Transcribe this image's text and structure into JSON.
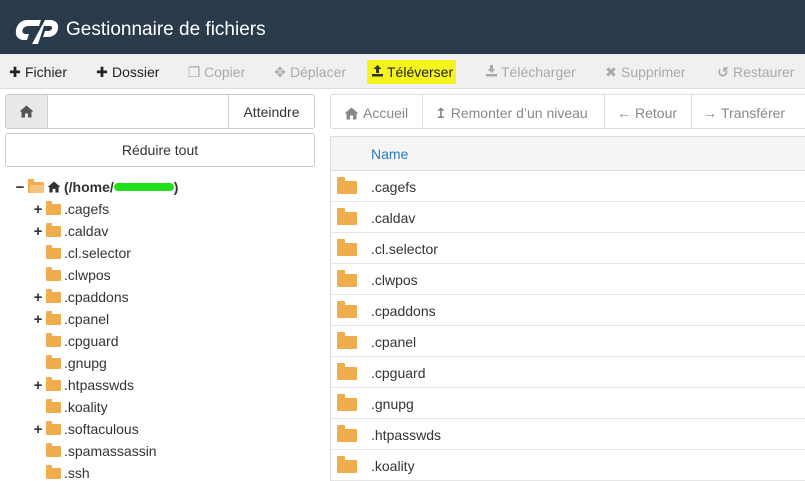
{
  "header": {
    "app_title": "Gestionnaire de fichiers",
    "brand_color": "#293a4a"
  },
  "toolbar": {
    "items": [
      {
        "label": "Fichier",
        "icon": "plus-icon",
        "enabled": true
      },
      {
        "label": "Dossier",
        "icon": "plus-icon",
        "enabled": true
      },
      {
        "label": "Copier",
        "icon": "copy-icon",
        "enabled": false
      },
      {
        "label": "Déplacer",
        "icon": "move-icon",
        "enabled": false
      },
      {
        "label": "Téléverser",
        "icon": "upload-icon",
        "enabled": true,
        "highlighted": true
      },
      {
        "label": "Télécharger",
        "icon": "download-icon",
        "enabled": false
      },
      {
        "label": "Supprimer",
        "icon": "close-icon",
        "enabled": false
      },
      {
        "label": "Restaurer",
        "icon": "undo-icon",
        "enabled": false
      }
    ],
    "highlight_color": "#f5f51d"
  },
  "left_panel": {
    "path_input_value": "",
    "go_label": "Atteindre",
    "collapse_label": "Réduire tout",
    "tree_root_label": "(/home/",
    "tree_root_suffix": ")",
    "tree_items": [
      {
        "name": ".cagefs",
        "expandable": true
      },
      {
        "name": ".caldav",
        "expandable": true
      },
      {
        "name": ".cl.selector",
        "expandable": false
      },
      {
        "name": ".clwpos",
        "expandable": false
      },
      {
        "name": ".cpaddons",
        "expandable": true
      },
      {
        "name": ".cpanel",
        "expandable": true
      },
      {
        "name": ".cpguard",
        "expandable": false
      },
      {
        "name": ".gnupg",
        "expandable": false
      },
      {
        "name": ".htpasswds",
        "expandable": true
      },
      {
        "name": ".koality",
        "expandable": false
      },
      {
        "name": ".softaculous",
        "expandable": true
      },
      {
        "name": ".spamassassin",
        "expandable": false
      },
      {
        "name": ".ssh",
        "expandable": false
      }
    ]
  },
  "right_panel": {
    "nav": [
      {
        "label": "Accueil",
        "icon": "home-icon"
      },
      {
        "label": "Remonter d’un niveau",
        "icon": "level-up-icon"
      },
      {
        "label": "Retour",
        "icon": "arrow-left-icon"
      },
      {
        "label": "Transférer",
        "icon": "arrow-right-icon"
      }
    ],
    "column_name": "Name",
    "files": [
      ".cagefs",
      ".caldav",
      ".cl.selector",
      ".clwpos",
      ".cpaddons",
      ".cpanel",
      ".cpguard",
      ".gnupg",
      ".htpasswds",
      ".koality"
    ]
  }
}
